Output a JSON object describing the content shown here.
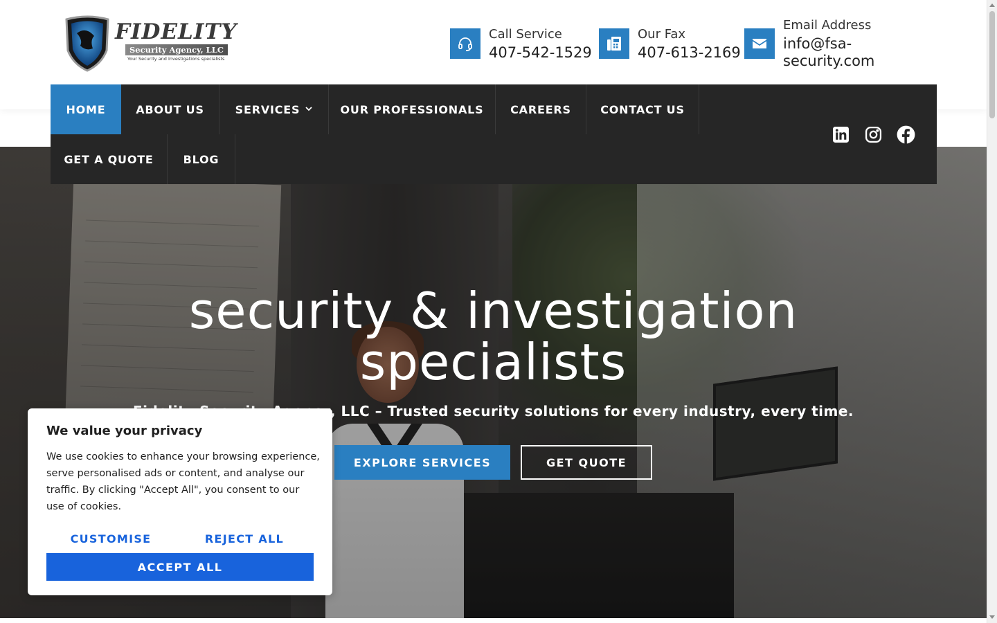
{
  "logo": {
    "title": "FIDELITY",
    "subtitle": "Security Agency, LLC",
    "tagline": "Your Security and Investigations specialists"
  },
  "contacts": [
    {
      "label": "Call Service",
      "value": "407-542-1529",
      "icon": "headset-icon"
    },
    {
      "label": "Our Fax",
      "value": "407-613-2169",
      "icon": "fax-icon"
    },
    {
      "label": "Email Address",
      "value": "info@fsa-security.com",
      "icon": "envelope-icon"
    }
  ],
  "nav": {
    "items": [
      {
        "label": "HOME",
        "active": true
      },
      {
        "label": "ABOUT US"
      },
      {
        "label": "SERVICES",
        "has_dropdown": true
      },
      {
        "label": "OUR PROFESSIONALS"
      },
      {
        "label": "CAREERS"
      },
      {
        "label": "CONTACT US"
      },
      {
        "label": "GET A QUOTE"
      },
      {
        "label": "BLOG"
      }
    ],
    "social": [
      "linkedin-icon",
      "instagram-icon",
      "facebook-icon"
    ]
  },
  "hero": {
    "title_line1": "security & investigation",
    "title_line2": "specialists",
    "subtitle": "Fidelity Security Agency, LLC – Trusted security solutions for every industry, every time.",
    "btn_explore": "EXPLORE SERVICES",
    "btn_quote": "GET QUOTE"
  },
  "cookie": {
    "title": "We value your privacy",
    "body": "We use cookies to enhance your browsing experience, serve personalised ads or content, and analyse our traffic. By clicking \"Accept All\", you consent to our use of cookies.",
    "customise": "CUSTOMISE",
    "reject": "REJECT ALL",
    "accept": "ACCEPT ALL"
  },
  "colors": {
    "accent": "#2a7fc1",
    "nav_bg": "#262626",
    "cookie_accent": "#1863dc"
  }
}
